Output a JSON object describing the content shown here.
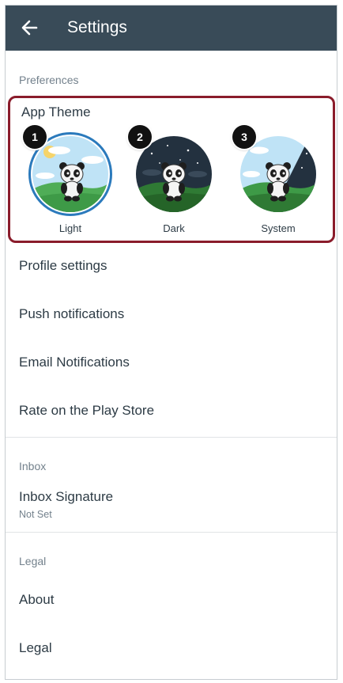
{
  "toolbar": {
    "title": "Settings",
    "back_icon": "arrow-left-icon"
  },
  "preferences": {
    "header": "Preferences",
    "app_theme": {
      "title": "App Theme",
      "selected": "Light",
      "highlight_color": "#8a1c2b",
      "options": [
        {
          "badge": "1",
          "label": "Light"
        },
        {
          "badge": "2",
          "label": "Dark"
        },
        {
          "badge": "3",
          "label": "System"
        }
      ]
    },
    "items": [
      {
        "label": "Profile settings"
      },
      {
        "label": "Push notifications"
      },
      {
        "label": "Email Notifications"
      },
      {
        "label": "Rate on the Play Store"
      }
    ]
  },
  "inbox": {
    "header": "Inbox",
    "signature": {
      "label": "Inbox Signature",
      "value": "Not Set"
    }
  },
  "legal": {
    "header": "Legal",
    "items": [
      {
        "label": "About"
      },
      {
        "label": "Legal"
      }
    ]
  },
  "colors": {
    "toolbar": "#394b58",
    "selection_ring": "#2b7abc",
    "text": "#2d3b45",
    "muted": "#73818c"
  }
}
